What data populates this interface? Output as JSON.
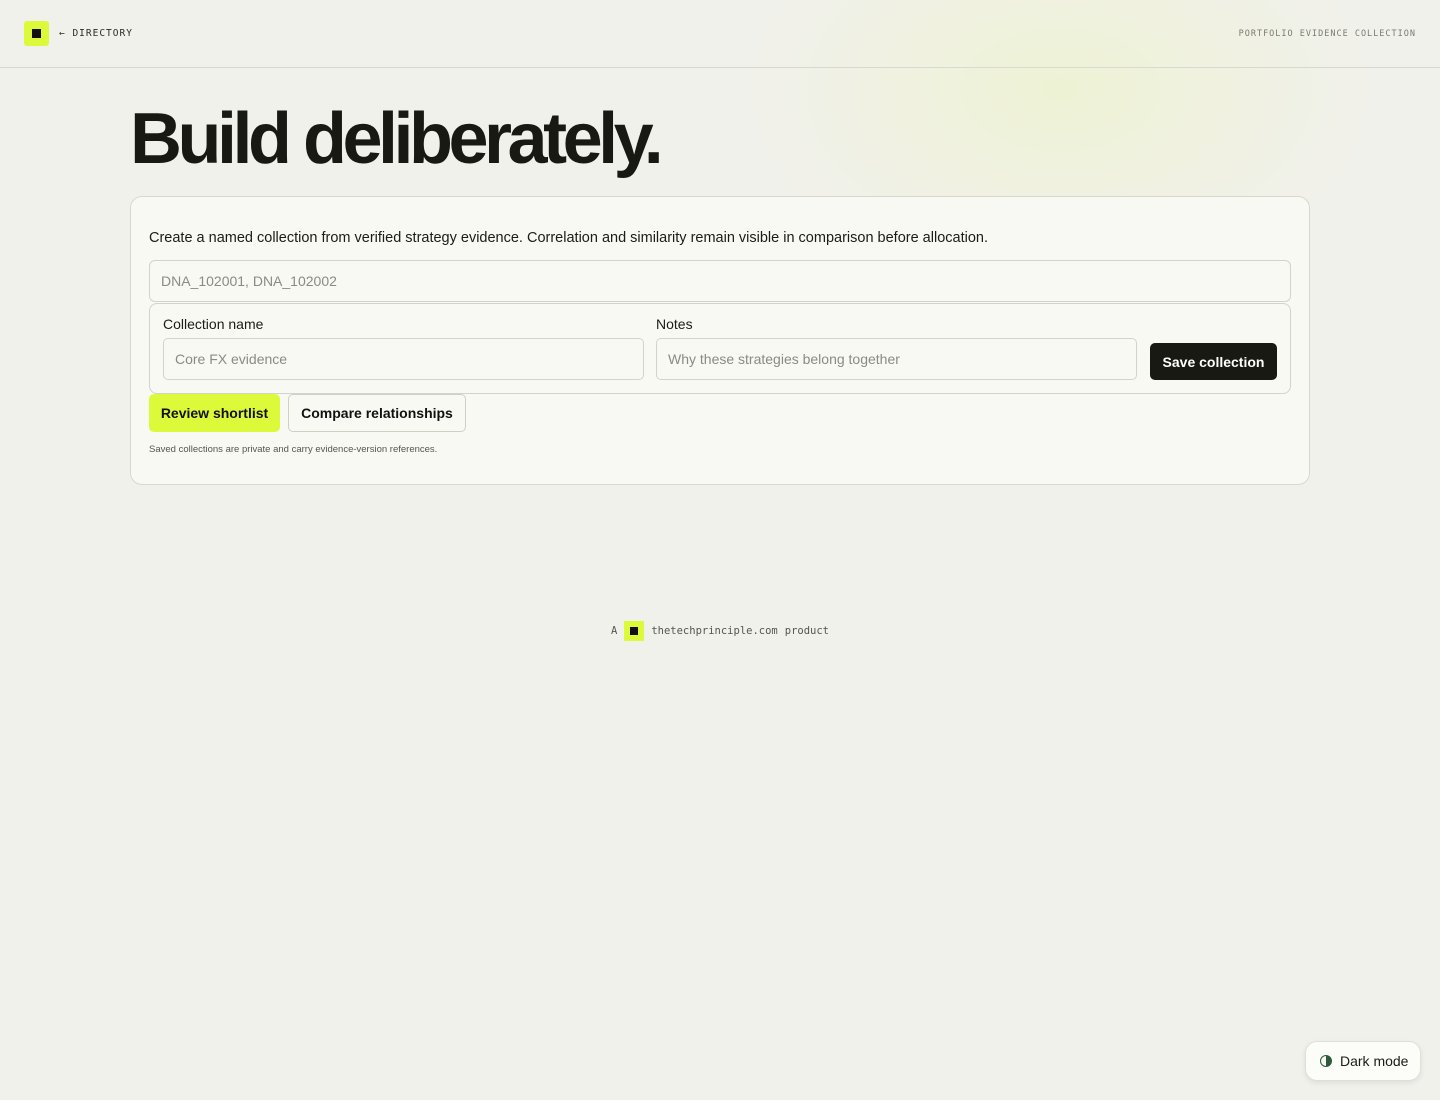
{
  "header": {
    "back_link": "← DIRECTORY",
    "section_title": "PORTFOLIO EVIDENCE COLLECTION"
  },
  "hero": {
    "title": "Build deliberately."
  },
  "collection_form": {
    "intro": "Create a named collection from verified strategy evidence. Correlation and similarity remain visible in comparison before allocation.",
    "ids_input": {
      "value": "",
      "placeholder": "DNA_102001, DNA_102002"
    },
    "name_field": {
      "label": "Collection name",
      "value": "",
      "placeholder": "Core FX evidence"
    },
    "notes_field": {
      "label": "Notes",
      "value": "",
      "placeholder": "Why these strategies belong together"
    },
    "save_label": "Save collection",
    "review_label": "Review shortlist",
    "compare_label": "Compare relationships",
    "footnote": "Saved collections are private and carry evidence-version references."
  },
  "footer": {
    "prefix": "A",
    "brand": "thetechprinciple.com",
    "suffix": "product"
  },
  "theme_toggle": {
    "label": "Dark mode",
    "icon": "half-circle-icon"
  },
  "colors": {
    "accent": "#dcfa3a",
    "ink": "#181913",
    "background": "#f1f1eb",
    "card": "#f9f9f4"
  }
}
